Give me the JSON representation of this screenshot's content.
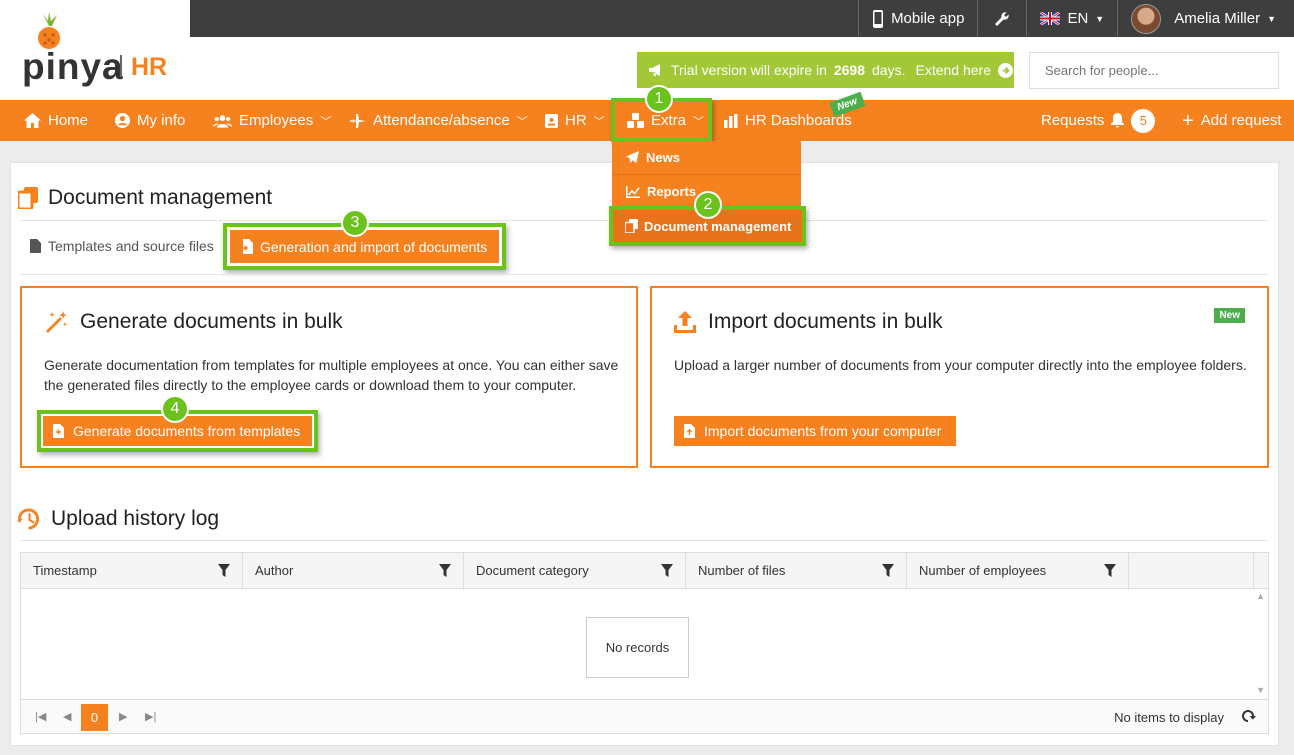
{
  "logo": {
    "brand": "pinya",
    "product": "HR"
  },
  "topbar": {
    "mobile_app": "Mobile app",
    "language": "EN",
    "user_name": "Amelia Miller"
  },
  "trial": {
    "prefix": "Trial version will expire in",
    "days": "2698",
    "suffix": "days.",
    "link": "Extend here"
  },
  "search": {
    "placeholder": "Search for people..."
  },
  "nav": {
    "home": "Home",
    "my_info": "My info",
    "employees": "Employees",
    "attendance": "Attendance/absence",
    "hr": "HR",
    "extra": "Extra",
    "hr_dashboards": "HR Dashboards",
    "new_flag": "New",
    "requests": "Requests",
    "requests_count": "5",
    "add_request": "Add request"
  },
  "dropdown": {
    "news": "News",
    "reports": "Reports",
    "document_management": "Document management"
  },
  "markers": [
    "1",
    "2",
    "3",
    "4"
  ],
  "page": {
    "title": "Document management",
    "tab_templates": "Templates and source files",
    "tab_generation": "Generation and import of documents"
  },
  "generate": {
    "title": "Generate documents in bulk",
    "description": "Generate documentation from templates for multiple employees at once. You can either save the generated files directly to the employee cards or download them to your computer.",
    "button": "Generate documents from templates"
  },
  "import": {
    "title": "Import documents in bulk",
    "badge": "New",
    "description": "Upload a larger number of documents from your computer directly into the employee folders.",
    "button": "Import documents from your computer"
  },
  "history": {
    "title": "Upload history log",
    "columns": [
      "Timestamp",
      "Author",
      "Document category",
      "Number of files",
      "Number of employees"
    ],
    "no_records": "No records",
    "current_page": "0",
    "no_items": "No items to display"
  },
  "colors": {
    "accent": "#f5821f",
    "highlight": "#6cc21c",
    "trial": "#a2c837",
    "topbar": "#3e3e3e"
  }
}
